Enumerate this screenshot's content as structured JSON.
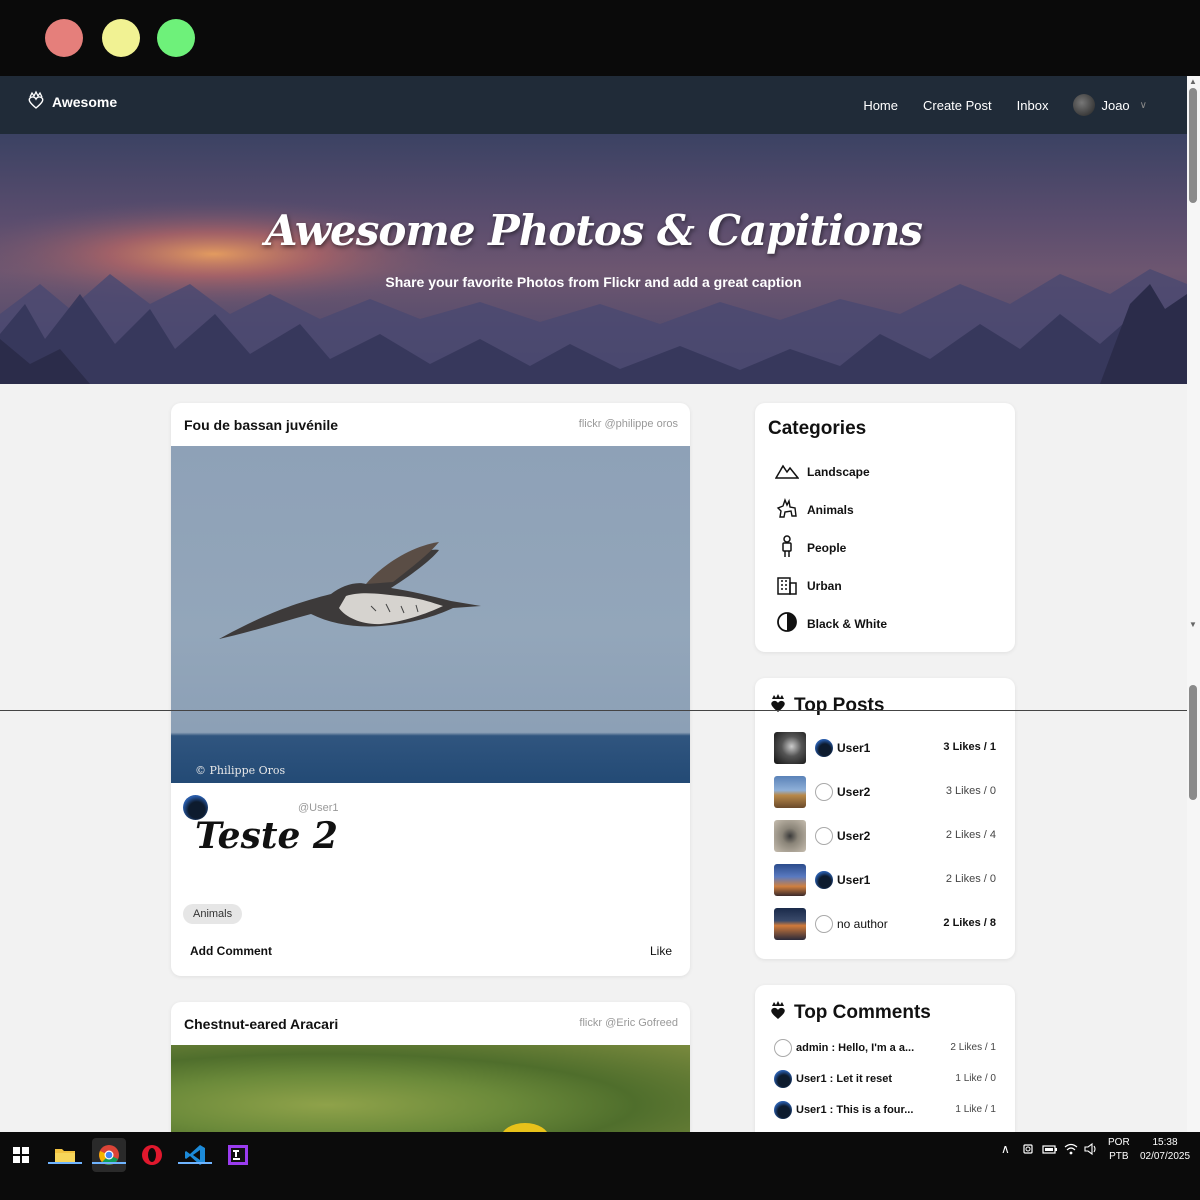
{
  "window": {
    "controls": [
      "close",
      "minimize",
      "maximize"
    ]
  },
  "navbar": {
    "brand": "Awesome",
    "links": [
      "Home",
      "Create Post",
      "Inbox"
    ],
    "user_name": "Joao"
  },
  "hero": {
    "title": "Awesome Photos & Capitions",
    "subtitle": "Share your favorite Photos from Flickr and add a great caption"
  },
  "posts": [
    {
      "title": "Fou de bassan juvénile",
      "credit": "flickr @philippe oros",
      "image_watermark": "© Philippe Oros",
      "handle": "@User1",
      "caption": "Teste 2",
      "tag": "Animals",
      "add_comment": "Add Comment",
      "like": "Like"
    },
    {
      "title": "Chestnut-eared Aracari",
      "credit": "flickr @Eric Gofreed"
    }
  ],
  "categories": {
    "title": "Categories",
    "items": [
      {
        "label": "Landscape",
        "icon": "landscape-icon"
      },
      {
        "label": "Animals",
        "icon": "animals-icon"
      },
      {
        "label": "People",
        "icon": "person-icon"
      },
      {
        "label": "Urban",
        "icon": "building-icon"
      },
      {
        "label": "Black & White",
        "icon": "contrast-icon"
      }
    ]
  },
  "top_posts": {
    "title": "Top Posts",
    "items": [
      {
        "user": "User1",
        "likes": "3 Likes / 1",
        "bold": true
      },
      {
        "user": "User2",
        "likes": "3 Likes / 0",
        "bold": false
      },
      {
        "user": "User2",
        "likes": "2 Likes / 4",
        "bold": false
      },
      {
        "user": "User1",
        "likes": "2 Likes / 0",
        "bold": false
      },
      {
        "user": "no author",
        "likes": "2 Likes / 8",
        "bold": true
      }
    ]
  },
  "top_comments": {
    "title": "Top Comments",
    "items": [
      {
        "text": "admin : Hello, I'm a a...",
        "likes": "2 Likes / 1"
      },
      {
        "text": "User1 : Let it reset",
        "likes": "1 Like / 0"
      },
      {
        "text": "User1 : This is a four...",
        "likes": "1 Like / 1"
      }
    ]
  },
  "taskbar": {
    "language": "POR",
    "layout": "PTB",
    "time": "15:38",
    "date": "02/07/2025"
  },
  "colors": {
    "navbar_bg": "#202b38",
    "page_bg": "#f2f2f2",
    "taskbar_bg": "#0b0b0b"
  }
}
